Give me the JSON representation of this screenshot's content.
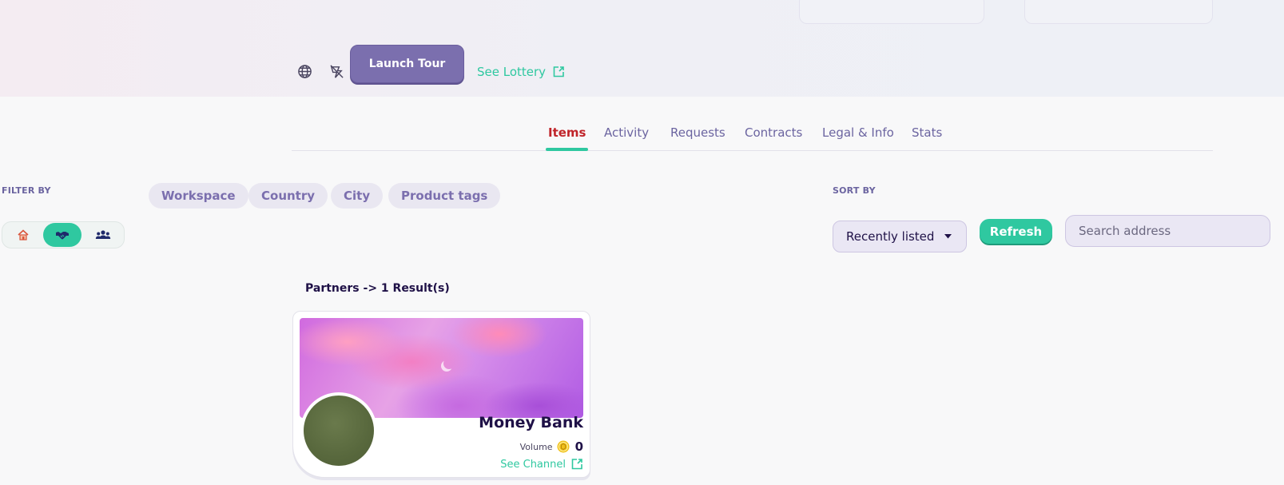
{
  "header": {
    "globe_icon": "globe-icon",
    "tour_icon": "tour-guide-icon",
    "launch_tour_label": "Launch Tour",
    "see_lottery_label": "See Lottery",
    "external_icon": "external-link-icon"
  },
  "tabs": [
    {
      "label": "Items",
      "active": true
    },
    {
      "label": "Activity",
      "active": false
    },
    {
      "label": "Requests",
      "active": false
    },
    {
      "label": "Contracts",
      "active": false
    },
    {
      "label": "Legal & Info",
      "active": false
    },
    {
      "label": "Stats",
      "active": false
    }
  ],
  "filters": {
    "label": "FILTER BY",
    "chips": [
      "Workspace",
      "Country",
      "City",
      "Product tags"
    ],
    "segments": [
      {
        "icon": "home-icon",
        "selected": false
      },
      {
        "icon": "handshake-icon",
        "selected": true
      },
      {
        "icon": "people-group-icon",
        "selected": false
      }
    ]
  },
  "sort": {
    "label": "SORT BY",
    "selected": "Recently listed",
    "refresh_label": "Refresh",
    "search_placeholder": "Search address"
  },
  "results": {
    "heading": "Partners -> 1 Result(s)",
    "cards": [
      {
        "title": "Money Bank",
        "volume_label": "Volume",
        "volume_value": "0",
        "see_channel_label": "See Channel",
        "coin_icon": "coin-icon"
      }
    ]
  },
  "colors": {
    "accent_green": "#2fc8a0",
    "primary_purple": "#7b6fae",
    "active_tab_red": "#c0242a",
    "text_dark": "#1f1147"
  }
}
